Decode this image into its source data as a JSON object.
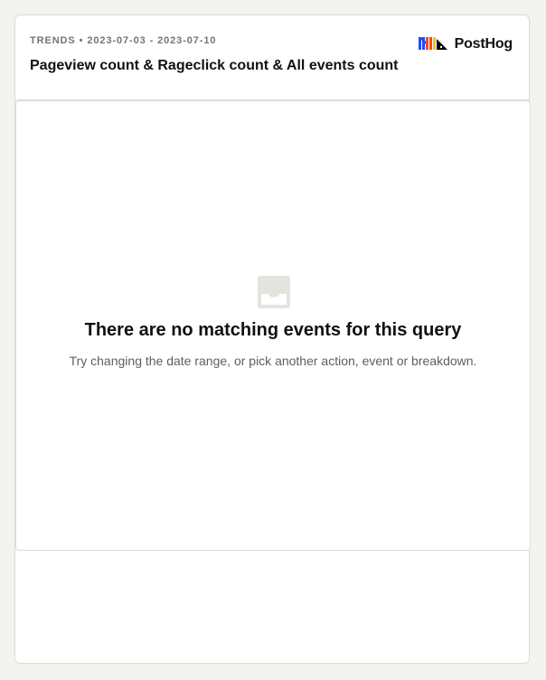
{
  "header": {
    "type_label": "TRENDS",
    "separator": "•",
    "date_range": "2023-07-03 - 2023-07-10",
    "title": "Pageview count & Rageclick count & All events count"
  },
  "brand": {
    "name": "PostHog",
    "logo_icon": "posthog-logo-icon",
    "colors": [
      "#1d4aff",
      "#f54e00",
      "#f9bd2b",
      "#000000"
    ]
  },
  "empty_state": {
    "icon": "inbox-icon",
    "title": "There are no matching events for this query",
    "subtitle": "Try changing the date range, or pick another action, event or breakdown."
  }
}
